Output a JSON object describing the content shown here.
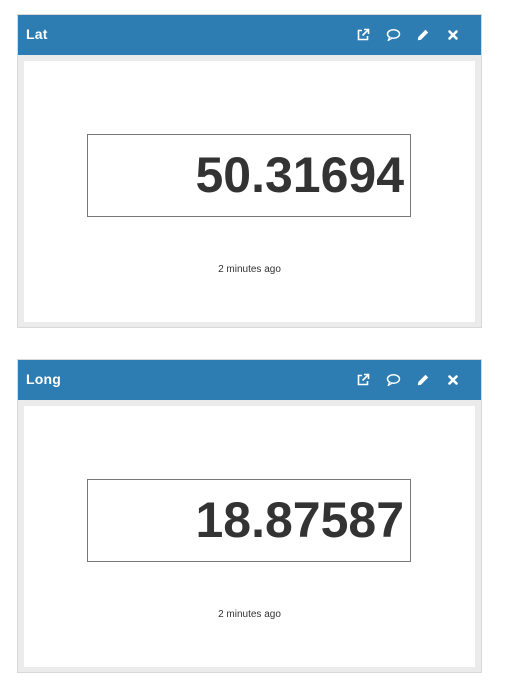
{
  "colors": {
    "header": "#2e7db2",
    "header_text": "#ffffff",
    "value_text": "#333333",
    "panel_background": "#ebebeb"
  },
  "widgets": [
    {
      "title": "Lat",
      "value": "50.31694",
      "updated": "2 minutes ago",
      "icons": [
        "external-link-icon",
        "comment-icon",
        "pencil-icon",
        "close-icon"
      ]
    },
    {
      "title": "Long",
      "value": "18.87587",
      "updated": "2 minutes ago",
      "icons": [
        "external-link-icon",
        "comment-icon",
        "pencil-icon",
        "close-icon"
      ]
    }
  ]
}
